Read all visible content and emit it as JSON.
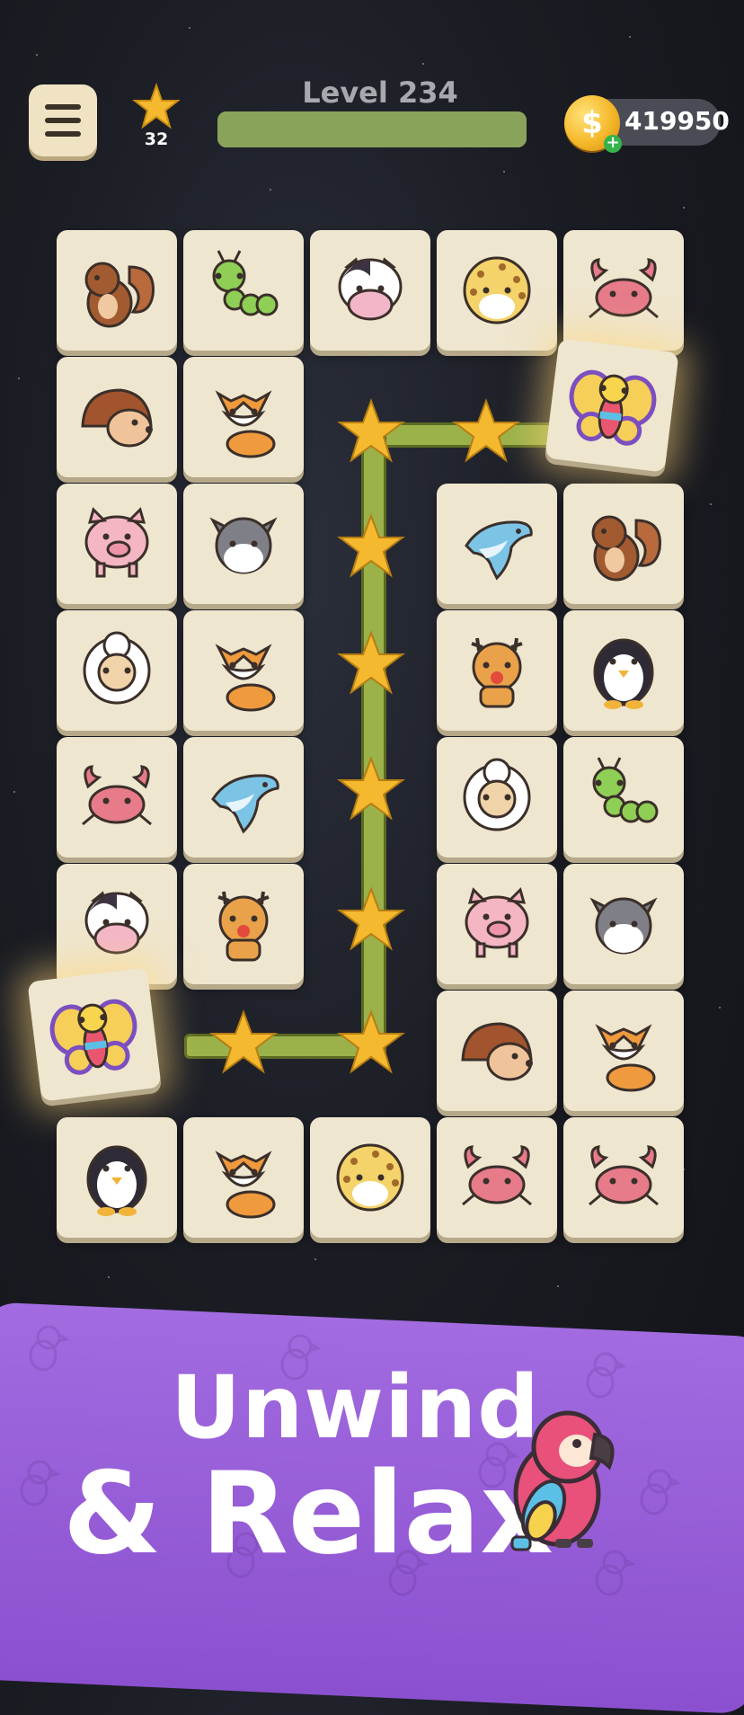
{
  "header": {
    "level_label": "Level 234",
    "star_count": "32",
    "coin_balance": "419950",
    "coin_symbol": "$",
    "coin_add": "+",
    "progress": 1.0
  },
  "board": {
    "tiles": [
      {
        "animal": "squirrel",
        "col": 0,
        "row": 0
      },
      {
        "animal": "caterpillar",
        "col": 1,
        "row": 0
      },
      {
        "animal": "cow",
        "col": 2,
        "row": 0
      },
      {
        "animal": "leopard",
        "col": 3,
        "row": 0
      },
      {
        "animal": "crab",
        "col": 4,
        "row": 0
      },
      {
        "animal": "hedgehog",
        "col": 0,
        "row": 1
      },
      {
        "animal": "fox",
        "col": 1,
        "row": 1
      },
      {
        "animal": "butterfly",
        "col": 4,
        "row": 1,
        "selected": true
      },
      {
        "animal": "pig",
        "col": 0,
        "row": 2
      },
      {
        "animal": "wolf",
        "col": 1,
        "row": 2
      },
      {
        "animal": "dolphin",
        "col": 3,
        "row": 2
      },
      {
        "animal": "squirrel",
        "col": 4,
        "row": 2
      },
      {
        "animal": "sheep",
        "col": 0,
        "row": 3
      },
      {
        "animal": "fox",
        "col": 1,
        "row": 3
      },
      {
        "animal": "deer",
        "col": 3,
        "row": 3
      },
      {
        "animal": "penguin",
        "col": 4,
        "row": 3
      },
      {
        "animal": "crab",
        "col": 0,
        "row": 4
      },
      {
        "animal": "dolphin",
        "col": 1,
        "row": 4
      },
      {
        "animal": "sheep",
        "col": 3,
        "row": 4
      },
      {
        "animal": "caterpillar",
        "col": 4,
        "row": 4
      },
      {
        "animal": "cow",
        "col": 0,
        "row": 5
      },
      {
        "animal": "deer",
        "col": 1,
        "row": 5
      },
      {
        "animal": "pig",
        "col": 3,
        "row": 5
      },
      {
        "animal": "wolf",
        "col": 4,
        "row": 5
      },
      {
        "animal": "butterfly",
        "col": 0,
        "row": 6,
        "selected": true
      },
      {
        "animal": "hedgehog",
        "col": 3,
        "row": 6
      },
      {
        "animal": "fox",
        "col": 4,
        "row": 6
      },
      {
        "animal": "penguin",
        "col": 0,
        "row": 7
      },
      {
        "animal": "fox",
        "col": 1,
        "row": 7
      },
      {
        "animal": "leopard",
        "col": 2,
        "row": 7
      },
      {
        "animal": "crab",
        "col": 3,
        "row": 7
      },
      {
        "animal": "crab",
        "col": 4,
        "row": 7
      }
    ]
  },
  "banner": {
    "line1": "Unwind",
    "line2": "& Relax",
    "mascot": "parrot"
  },
  "colors": {
    "tile": "#efe6cf",
    "path": "#9bb14a",
    "banner": "#9a62db",
    "star": "#f5b930"
  }
}
